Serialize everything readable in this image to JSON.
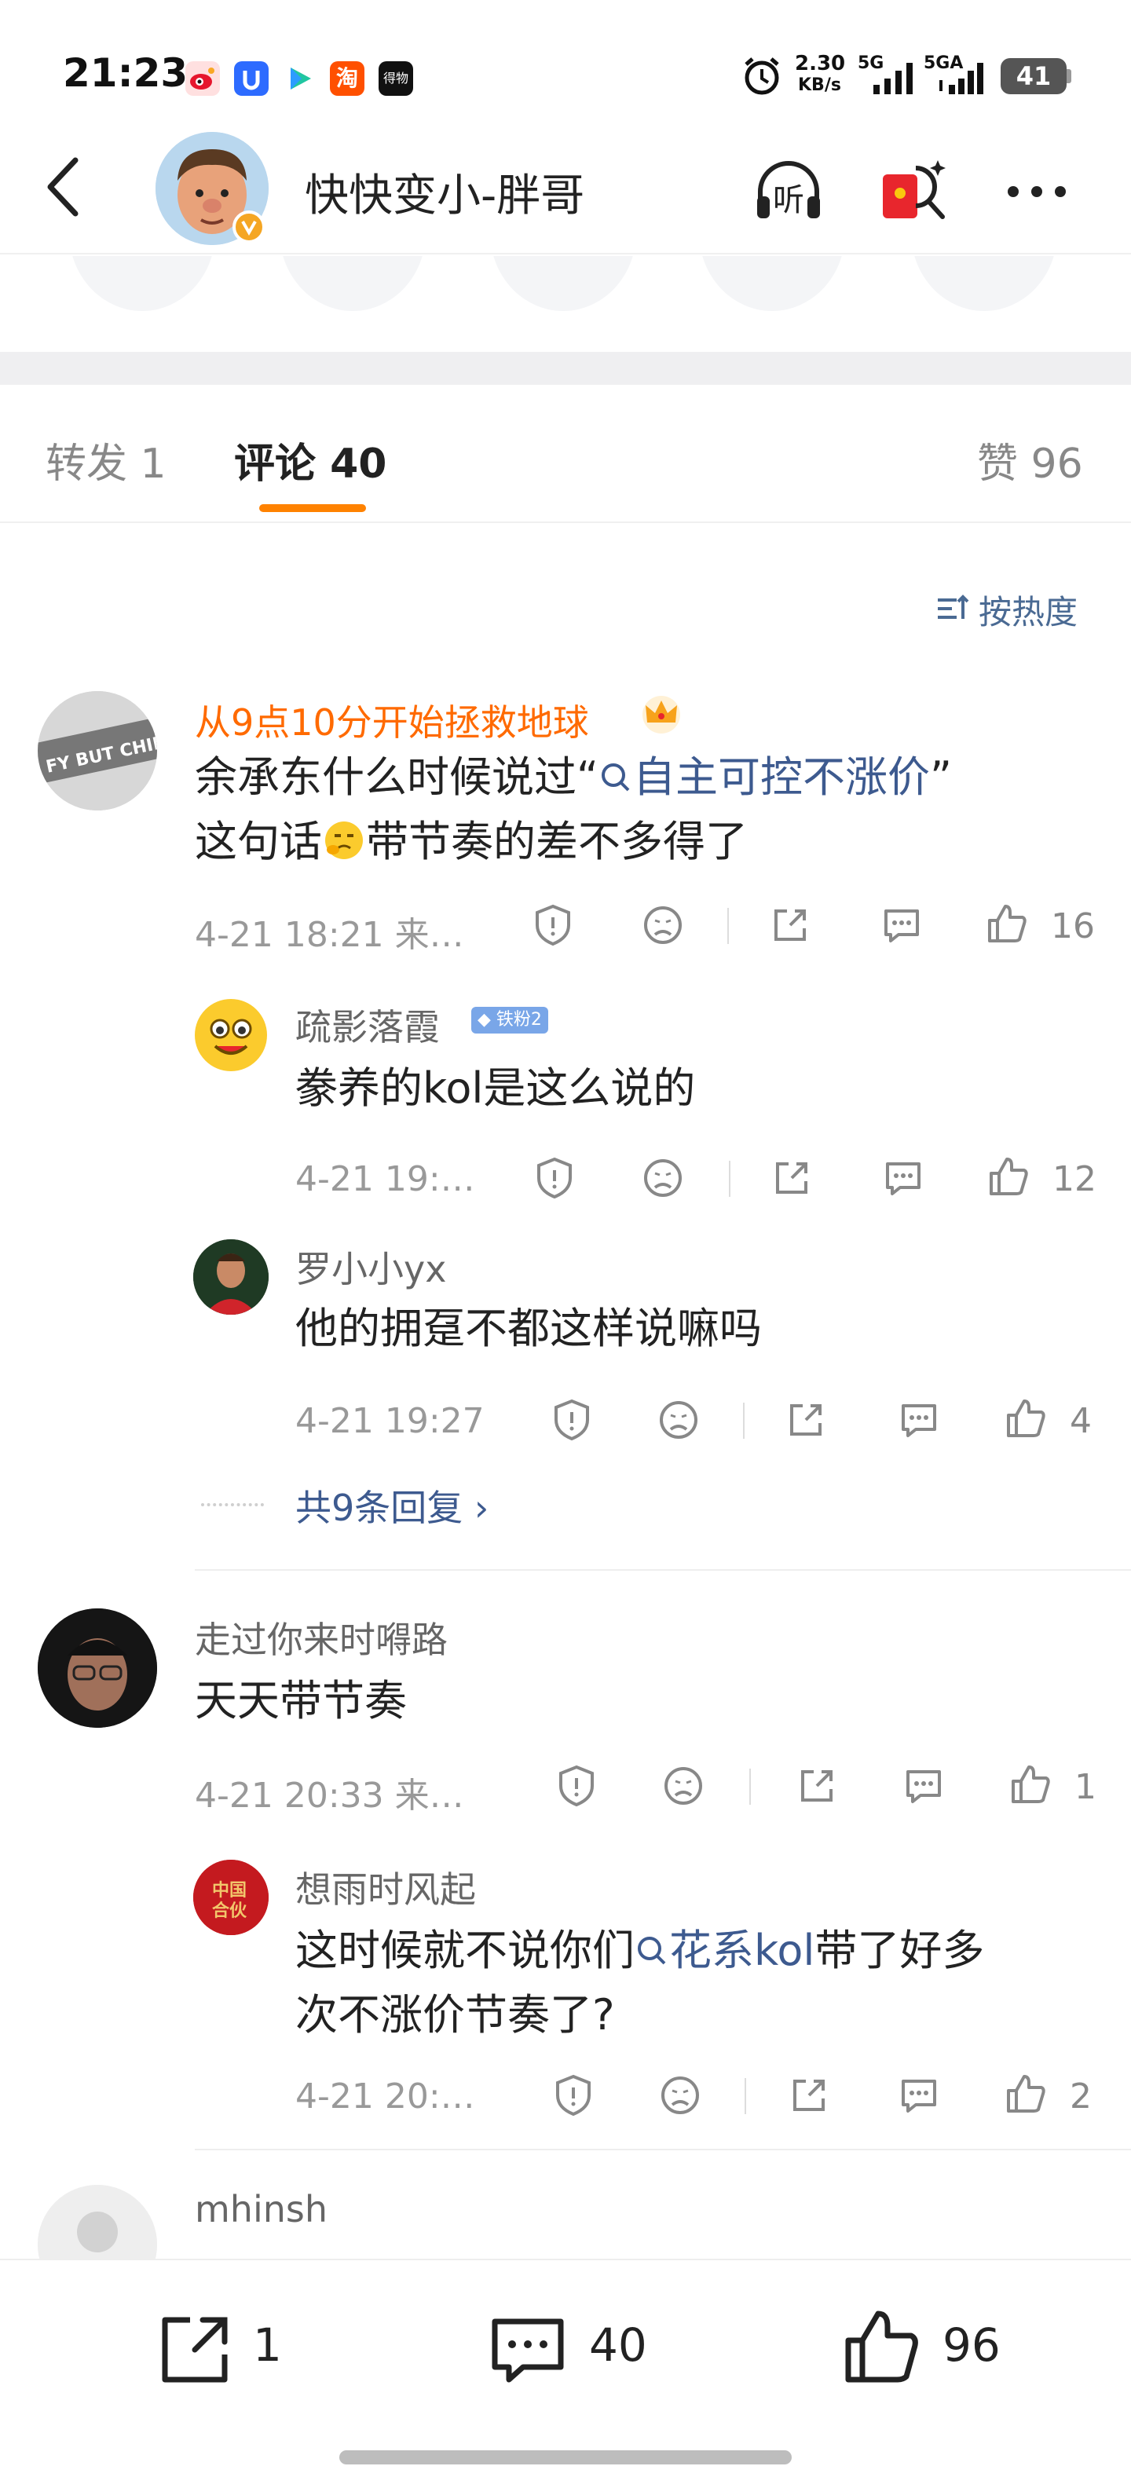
{
  "status_bar": {
    "time": "21:23",
    "network_speed_value": "2.30",
    "network_speed_unit": "KB/s",
    "sim1": "5G",
    "sim2": "5GA",
    "battery": "41",
    "apps": [
      {
        "icon": "weibo-icon",
        "color": "#e6162d"
      },
      {
        "icon": "shield-u-icon",
        "color": "#2d6bff"
      },
      {
        "icon": "play-icon",
        "color": "#21c6a1"
      },
      {
        "icon": "taobao-icon",
        "color": "#ff5000",
        "label": "淘"
      },
      {
        "icon": "dewu-icon",
        "color": "#111111",
        "label": "得物"
      }
    ]
  },
  "header": {
    "title": "快快变小-胖哥",
    "icons": [
      "back-icon",
      "listen-icon",
      "red-packet-icon",
      "more-icon"
    ],
    "listen_label": "听"
  },
  "tabs": {
    "repost": "转发 1",
    "comments": "评论 40",
    "likes": "赞 96",
    "active": "comments"
  },
  "sort_label": "按热度",
  "comments": [
    {
      "user": "从9点10分开始拯救地球",
      "user_color": "#ff6a00",
      "badge": "crown-icon",
      "text_before": "余承东什么时候说过“",
      "link": "自主可控不涨价",
      "text_after": "”",
      "text_line2": "这句话",
      "text_line2_after": "带节奏的差不多得了",
      "time": "4-21 18:21 来…",
      "likes": "16",
      "replies": [
        {
          "user": "疏影落霞",
          "fan_badge": "铁粉2",
          "text": "豢养的kol是这么说的",
          "time": "4-21 19:…",
          "likes": "12"
        },
        {
          "user": "罗小小yx",
          "text": "他的拥趸不都这样说嘛吗",
          "time": "4-21 19:27",
          "likes": "4"
        }
      ],
      "more_replies": "共9条回复"
    },
    {
      "user": "走过你来时嘚路",
      "text": "天天带节奏",
      "time": "4-21 20:33 来…",
      "likes": "1",
      "replies": [
        {
          "user": "想雨时风起",
          "text_before": "这时候就不说你们",
          "link": "花系kol",
          "text_after": "带了好多",
          "text_line2": "次不涨价节奏了?",
          "time": "4-21 20:…",
          "likes": "2"
        }
      ]
    },
    {
      "user": "mhinsh"
    }
  ],
  "bottom_bar": {
    "repost_count": "1",
    "comment_count": "40",
    "like_count": "96"
  },
  "colors": {
    "accent": "#ff8200",
    "link": "#3d5a8f"
  }
}
